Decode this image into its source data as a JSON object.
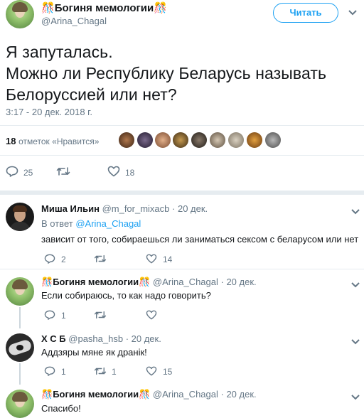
{
  "main_tweet": {
    "author_name": "Богиня мемологии",
    "author_handle": "@Arina_Chagal",
    "emoji_left": "🎊",
    "emoji_right": "🎊",
    "follow_label": "Читать",
    "text_line1": "Я запуталась.",
    "text_line2": "Можно ли Республику Беларусь называть",
    "text_line3": "Белоруссией или нет?",
    "timestamp": "3:17 - 20 дек. 2018 г.",
    "likes_count": "18",
    "likes_label": "отметок «Нравится»",
    "reply_count": "25",
    "retweet_count": "",
    "like_count": "18",
    "accent_color": "#1da1f2"
  },
  "replies": [
    {
      "name": "Миша Ильин",
      "handle": "@m_for_mixacb",
      "date": "· 20 дек.",
      "reply_to_prefix": "В ответ",
      "reply_to_handle": "@Arina_Chagal",
      "text": "зависит от того, собираешься ли заниматься сексом с беларусом или нет",
      "reply_count": "2",
      "retweet_count": "",
      "like_count": "14"
    },
    {
      "name": "Богиня мемологии",
      "handle": "@Arina_Chagal",
      "date": "· 20 дек.",
      "emoji_left": "🎊",
      "emoji_right": "🎊",
      "text": "Если собираюсь, то как надо говорить?",
      "reply_count": "1",
      "retweet_count": "",
      "like_count": ""
    },
    {
      "name": "Х С Б",
      "handle": "@pasha_hsb",
      "date": "· 20 дек.",
      "text": "Аддзяры мяне як дранік!",
      "reply_count": "1",
      "retweet_count": "1",
      "like_count": "15"
    },
    {
      "name": "Богиня мемологии",
      "handle": "@Arina_Chagal",
      "date": "· 20 дек.",
      "emoji_left": "🎊",
      "emoji_right": "🎊",
      "text": "Спасибо!"
    }
  ]
}
